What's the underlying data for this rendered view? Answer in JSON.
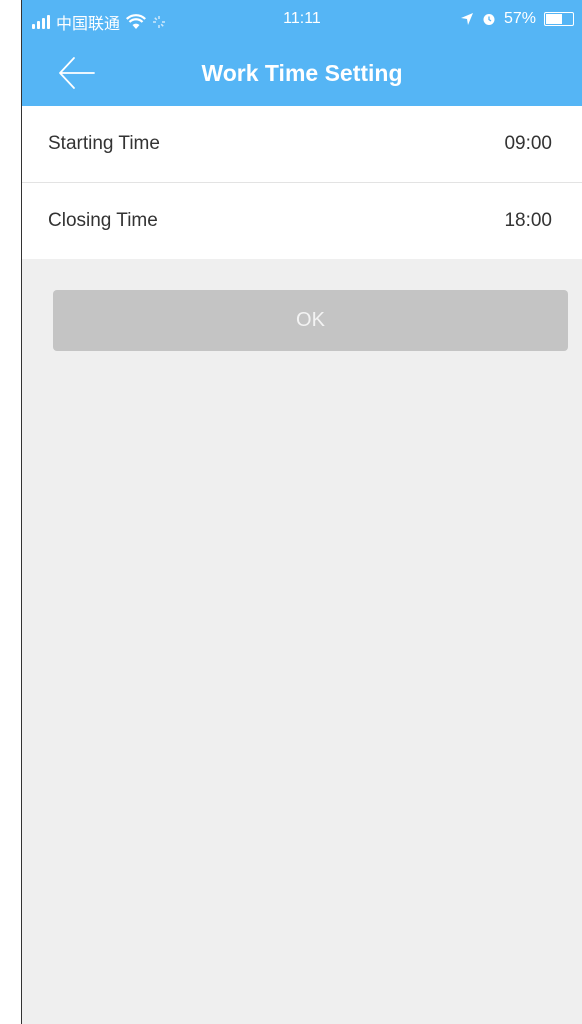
{
  "status_bar": {
    "carrier": "中国联通",
    "time": "11:11",
    "battery_percent": "57%",
    "battery_level": 0.57
  },
  "nav": {
    "title": "Work Time Setting"
  },
  "settings": [
    {
      "label": "Starting Time",
      "value": "09:00"
    },
    {
      "label": "Closing Time",
      "value": "18:00"
    }
  ],
  "ok_label": "OK",
  "colors": {
    "header": "#55b5f5",
    "background": "#efefef",
    "button_disabled": "#c4c4c4"
  }
}
